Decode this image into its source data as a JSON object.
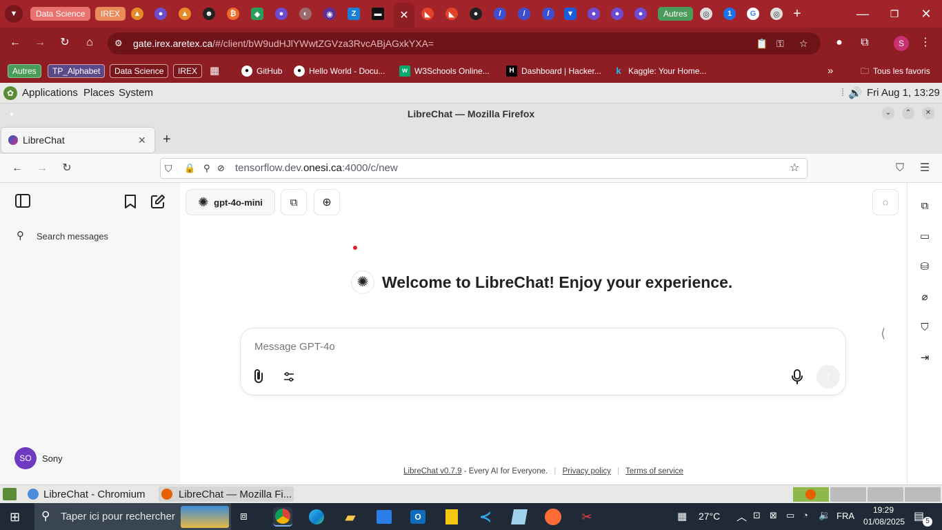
{
  "chrome": {
    "tab_chips": [
      {
        "label": "Data Science",
        "color": "#e8736e"
      },
      {
        "label": "IREX",
        "color": "#e98a5a"
      },
      {
        "label": "Autres",
        "color": "#4b9c58"
      }
    ],
    "url_host": "gate.irex.aretex.ca",
    "url_path": "/#/client/bW9udHJlYWwtZGVza3RvcABjAGxkYXA=",
    "profile_initial": "S",
    "bookmarks": [
      {
        "label": "Autres",
        "chip": true
      },
      {
        "label": "TP_Alphabet",
        "chip": true
      },
      {
        "label": "Data Science",
        "chip": true
      },
      {
        "label": "IREX",
        "chip": true
      },
      {
        "label": "GitHub"
      },
      {
        "label": "Hello World - Docu..."
      },
      {
        "label": "W3Schools Online..."
      },
      {
        "label": "Dashboard | Hacker..."
      },
      {
        "label": "Kaggle: Your Home..."
      }
    ],
    "all_bookmarks": "Tous les favoris",
    "accent": "#a3232b"
  },
  "gnome": {
    "menu": [
      "Applications",
      "Places",
      "System"
    ],
    "clock": "Fri Aug 1, 13:29",
    "window_list": [
      "LibreChat - Chromium",
      "LibreChat — Mozilla Fi..."
    ]
  },
  "firefox": {
    "window_title": "LibreChat — Mozilla Firefox",
    "tab_label": "LibreChat",
    "url_prefix": "tensorflow.dev.",
    "url_host": "onesi.ca",
    "url_suffix": ":4000/c/new"
  },
  "librechat": {
    "search_placeholder": "Search messages",
    "model_label": "gpt-4o-mini",
    "welcome": "Welcome to LibreChat! Enjoy your experience.",
    "composer_placeholder": "Message GPT-4o",
    "user_initials": "SO",
    "user_name": "Sony",
    "footer_version": "LibreChat v0.7.9",
    "footer_tagline": " - Every AI for Everyone.",
    "footer_privacy": "Privacy policy",
    "footer_terms": "Terms of service",
    "avatar_color": "#6d3bc2"
  },
  "taskbar": {
    "search_placeholder": "Taper ici pour rechercher",
    "weather": "27°C",
    "lang": "FRA",
    "time": "19:29",
    "date": "01/08/2025",
    "notifications": "5"
  }
}
